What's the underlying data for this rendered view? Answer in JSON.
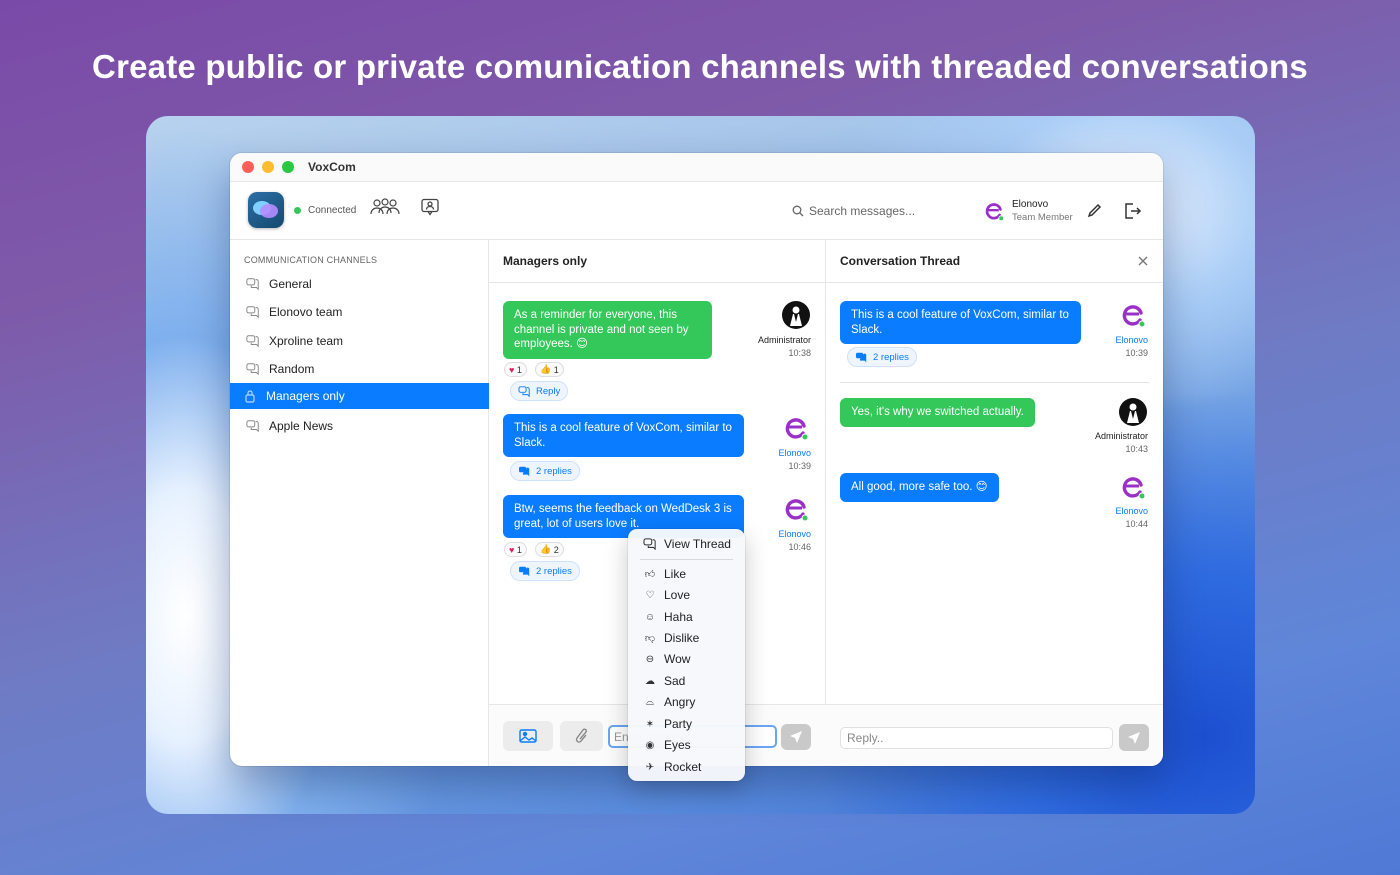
{
  "headline": "Create public or private comunication channels with threaded conversations",
  "window": {
    "title": "VoxCom"
  },
  "toolbar": {
    "status": "Connected",
    "search_placeholder": "Search messages...",
    "user": {
      "name": "Elonovo",
      "role": "Team Member"
    }
  },
  "sidebar": {
    "header": "COMMUNICATION CHANNELS",
    "items": [
      {
        "label": "General"
      },
      {
        "label": "Elonovo team"
      },
      {
        "label": "Xproline team"
      },
      {
        "label": "Random"
      },
      {
        "label": "Managers only",
        "active": true,
        "private": true
      },
      {
        "label": "Apple News"
      }
    ]
  },
  "channel": {
    "title": "Managers only",
    "messages": [
      {
        "text": "As a reminder for everyone, this channel is private and not seen by employees. 😊",
        "author": "Administrator",
        "time": "10:38",
        "color": "#34c759",
        "reactions": [
          {
            "emoji": "❤️",
            "count": "1"
          },
          {
            "emoji": "👍",
            "count": "1"
          }
        ],
        "action": "Reply"
      },
      {
        "text": "This is a cool feature of VoxCom, similar to Slack.",
        "author": "Elonovo",
        "time": "10:39",
        "color": "#0a7cff",
        "action": "2 replies"
      },
      {
        "text": "Btw, seems the feedback on WedDesk 3 is great, lot of users love it.",
        "author": "Elonovo",
        "time": "10:46",
        "color": "#0a7cff",
        "reactions": [
          {
            "emoji": "❤️",
            "count": "1"
          },
          {
            "emoji": "👍",
            "count": "2"
          }
        ],
        "action": "2 replies"
      }
    ],
    "composer_placeholder": "Enter message..."
  },
  "thread": {
    "title": "Conversation Thread",
    "root": {
      "text": "This is a cool feature of VoxCom, similar to Slack.",
      "author": "Elonovo",
      "time": "10:39",
      "action": "2 replies"
    },
    "replies": [
      {
        "text": "Yes, it's why we switched actually.",
        "author": "Administrator",
        "time": "10:43",
        "color": "#34c759"
      },
      {
        "text": "All good, more safe too. 😊",
        "author": "Elonovo",
        "time": "10:44",
        "color": "#0a7cff"
      }
    ],
    "reply_placeholder": "Reply.."
  },
  "context_menu": {
    "items": [
      {
        "label": "View Thread",
        "icon": "thread-icon"
      },
      {
        "label": "Like",
        "icon": "thumbs-up-icon"
      },
      {
        "label": "Love",
        "icon": "heart-icon"
      },
      {
        "label": "Haha",
        "icon": "laugh-icon"
      },
      {
        "label": "Dislike",
        "icon": "thumbs-down-icon"
      },
      {
        "label": "Wow",
        "icon": "wow-icon"
      },
      {
        "label": "Sad",
        "icon": "sad-icon"
      },
      {
        "label": "Angry",
        "icon": "angry-icon"
      },
      {
        "label": "Party",
        "icon": "party-icon"
      },
      {
        "label": "Eyes",
        "icon": "eyes-icon"
      },
      {
        "label": "Rocket",
        "icon": "rocket-icon"
      }
    ]
  },
  "colors": {
    "accent": "#0a7cff",
    "green": "#34c759",
    "brand_purple": "#9b30c8"
  }
}
